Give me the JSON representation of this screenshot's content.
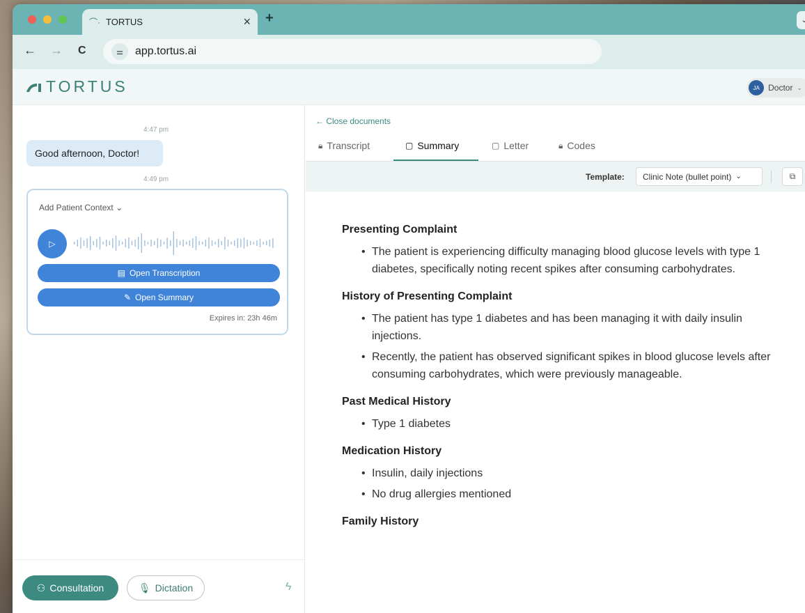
{
  "browser": {
    "tab_title": "TORTUS",
    "tab_close": "×",
    "new_tab": "+",
    "tab_menu": "⌄",
    "url": "app.tortus.ai",
    "nav": {
      "back": "←",
      "forward": "→",
      "reload": "C"
    }
  },
  "app": {
    "brand": "TORTUS",
    "user": {
      "initials": "JA",
      "name": "Doctor"
    }
  },
  "chat": {
    "messages": [
      {
        "time": "4:47 pm",
        "text": "Good afternoon, Doctor!"
      }
    ],
    "recording": {
      "time": "4:49 pm",
      "context_label": "Add Patient Context",
      "open_transcription": "Open Transcription",
      "open_summary": "Open Summary",
      "expires": "Expires in: 23h 46m"
    },
    "modes": {
      "consultation": "Consultation",
      "dictation": "Dictation"
    }
  },
  "documents": {
    "close_label": "Close documents",
    "tabs": [
      {
        "label": "Transcript",
        "active": false
      },
      {
        "label": "Summary",
        "active": true
      },
      {
        "label": "Letter",
        "active": false
      },
      {
        "label": "Codes",
        "active": false
      }
    ],
    "template_label": "Template:",
    "template_value": "Clinic Note (bullet point)",
    "sections": [
      {
        "heading": "Presenting Complaint",
        "items": [
          "The patient is experiencing difficulty managing blood glucose levels with type 1 diabetes, specifically noting recent spikes after consuming carbohydrates."
        ]
      },
      {
        "heading": "History of Presenting Complaint",
        "items": [
          "The patient has type 1 diabetes and has been managing it with daily insulin injections.",
          "Recently, the patient has observed significant spikes in blood glucose levels after consuming carbohydrates, which were previously manageable."
        ]
      },
      {
        "heading": "Past Medical History",
        "items": [
          "Type 1 diabetes"
        ]
      },
      {
        "heading": "Medication History",
        "items": [
          "Insulin, daily injections",
          "No drug allergies mentioned"
        ]
      },
      {
        "heading": "Family History",
        "items": []
      }
    ]
  },
  "colors": {
    "accent": "#3c8a80",
    "primary_blue": "#3f84d8",
    "chrome": "#6cb3b3"
  }
}
